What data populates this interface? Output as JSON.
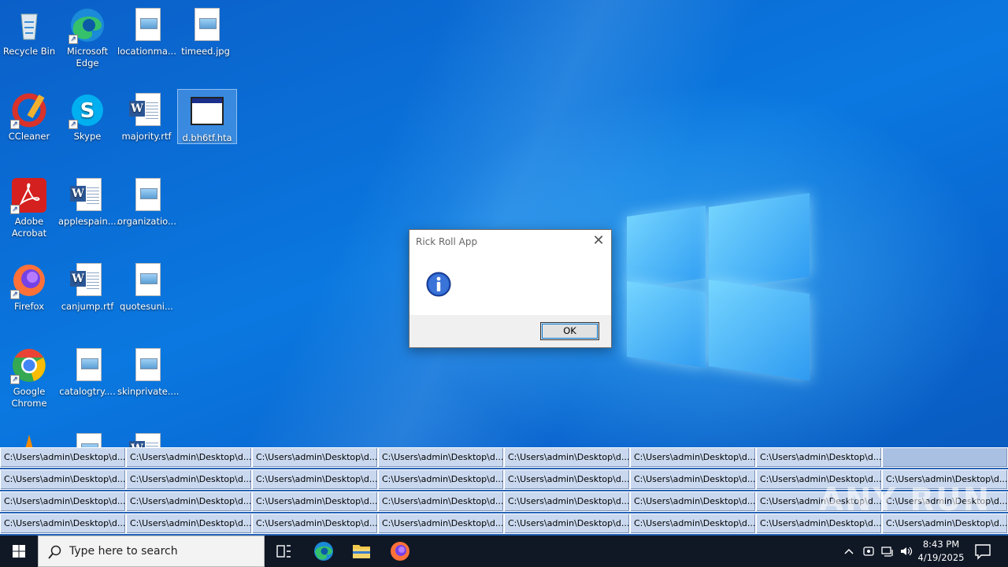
{
  "desktop": {
    "icons": [
      {
        "label": "Recycle Bin"
      },
      {
        "label": "Microsoft Edge"
      },
      {
        "label": "locationma..."
      },
      {
        "label": "timeed.jpg"
      },
      {
        "label": "CCleaner"
      },
      {
        "label": "Skype"
      },
      {
        "label": "majority.rtf"
      },
      {
        "label": "d.bh6tf.hta"
      },
      {
        "label": "Adobe Acrobat"
      },
      {
        "label": "applespain...."
      },
      {
        "label": "organizatio..."
      },
      {
        "label": "Firefox"
      },
      {
        "label": "canjump.rtf"
      },
      {
        "label": "quotesuni..."
      },
      {
        "label": "Google Chrome"
      },
      {
        "label": "catalogtry...."
      },
      {
        "label": "skinprivate...."
      }
    ]
  },
  "dialog": {
    "title": "Rick Roll App",
    "ok_label": "OK",
    "close_glyph": "✕"
  },
  "grid": {
    "cell_label": "C:\\Users\\admin\\Desktop\\d..."
  },
  "watermark": "ANY RUN",
  "taskbar": {
    "search_placeholder": "Type here to search",
    "time": "8:43 PM",
    "date": "4/19/2025"
  }
}
